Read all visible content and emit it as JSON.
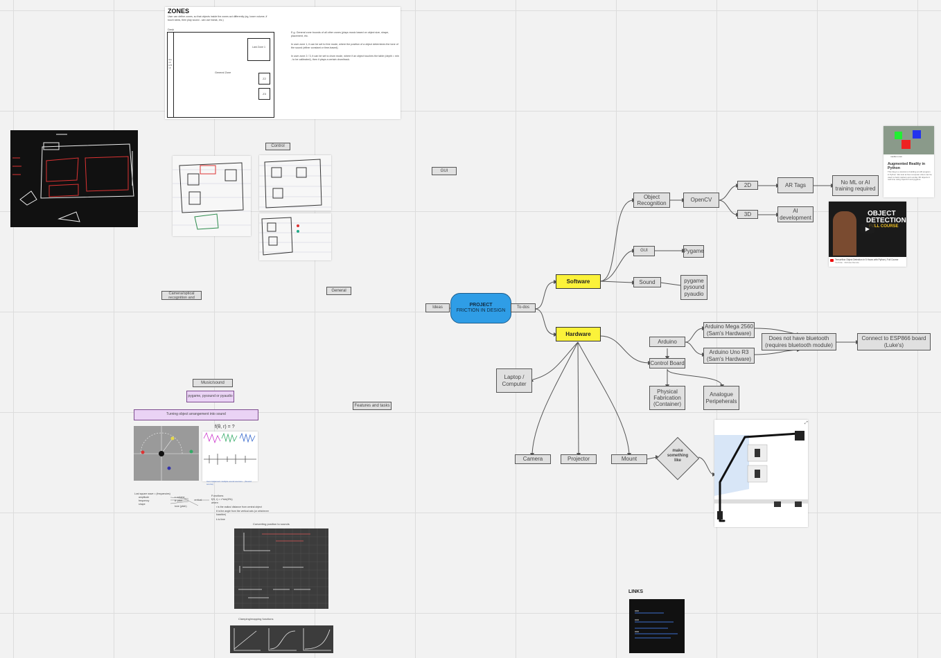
{
  "center": {
    "title": "PROJECT",
    "subtitle": "FRICTION IN DESIGN"
  },
  "branches": {
    "ideas": "Ideas",
    "todos": "To-dos",
    "software": "Software",
    "hardware": "Hardware"
  },
  "software": {
    "object_recognition": "Object Recognition",
    "opencv": "OpenCV",
    "two_d": "2D",
    "three_d": "3D",
    "ar_tags": "AR Tags",
    "no_ml": "No ML or AI training required",
    "ai_dev": "AI development",
    "gui": "GUI",
    "pygame": "Pygame",
    "sound": "Sound",
    "sound_libs": "pygame pysound pyaudio"
  },
  "hardware": {
    "arduino": "Arduino",
    "mega": "Arduino Mega 2560 (Sam's Hardware)",
    "uno": "Arduino Uno R3 (Sam's Hardware)",
    "no_bt": "Does not have bluetooth (requires bluetooth module)",
    "esp": "Connect to ESP866 board (Luke's)",
    "control_board": "Control Board",
    "fabrication": "Physical Fabrication (Container)",
    "analogue": "Analogue Peripeherals",
    "laptop": "Laptop / Computer",
    "camera": "Camera",
    "projector": "Projector",
    "mount": "Mount",
    "make_like": "make something like"
  },
  "ideas_area": {
    "gui": "GUI",
    "control": "Control",
    "general": "General",
    "camera_optical": "Camera/optical recognition and",
    "music_sound": "Music/sound",
    "pygame_libs": "pygame, pysound or pyaudio",
    "features": "Features and tasks",
    "turning": "Turning object arrangement into sound"
  },
  "zones": {
    "title": "ZONES",
    "intro": "User can define zones, so that objects inside the zones act differently (eg, lower volume, if touch sleds, then play sound - can use tweak, etc.)",
    "desk": "Desk",
    "last_zone": "Last Zone 1",
    "general_zone": "General Zone",
    "z2": "Z2",
    "z3": "Z3",
    "side": "ALL / A & B / Z",
    "note1": "E.g. General zone bounds of all other zones (plays music based on object size, shape, placement, etc.",
    "note2": "In user zone 1, it can be set to free mode, where the position of a object determines the tone of the sound (either constant or time-based).",
    "note3": "In user zone 2 / 3, it can be set to drum mode, where if an object touches the table (depth = min - to be calibrated), then it plays a certain drum/track."
  },
  "labels": {
    "converting": "Converting position to sounds",
    "clamping": "Clamping/mapping functions",
    "links": "LINKS",
    "formula": "f(θ, r) = ?",
    "wave_caption": "Can implement multiple sound sources... (Sound source)",
    "funcs_title": "Functions",
    "func_expr": "f(θ, r) = r*sin(θ*k)",
    "func_where": "where:",
    "func_b1": "r is the radius/ distance from central object",
    "func_b2": "θ is the angle from the vertical axis (or whichever baseline)",
    "func_b3": "k is time",
    "left_list": "Lost square wave = (frequencies)",
    "left_1": "amplitude",
    "left_2": "frequency",
    "left_3": "shape",
    "mid_1": "r: volume",
    "mid_2": "θ: pitch",
    "mid_3": "vertical",
    "mid_4": "tone (pitch)"
  },
  "ar_card": {
    "site": "medium.com",
    "title": "Augmented Reality in Python",
    "desc": "This blog is a tutorial on building an AR program in Python. We look at how computer vision can be used to track markers and overlay 3D objects in real time using OpenCV and pygame."
  },
  "video_card": {
    "thumb_line1": "OBJECT",
    "thumb_line2": "DETECTION",
    "thumb_line3": "FULL COURSE",
    "title": "Tensorflow Object Detection in 5 Hours with Python | Full Course with 3 Projects",
    "channel": "YouTube · Nicholas Renotte"
  },
  "colors": {
    "accent_yellow": "#fbf23a",
    "center_blue": "#2f9de6",
    "purple": "#ead3f5",
    "node_grey": "#e0e0e0"
  }
}
